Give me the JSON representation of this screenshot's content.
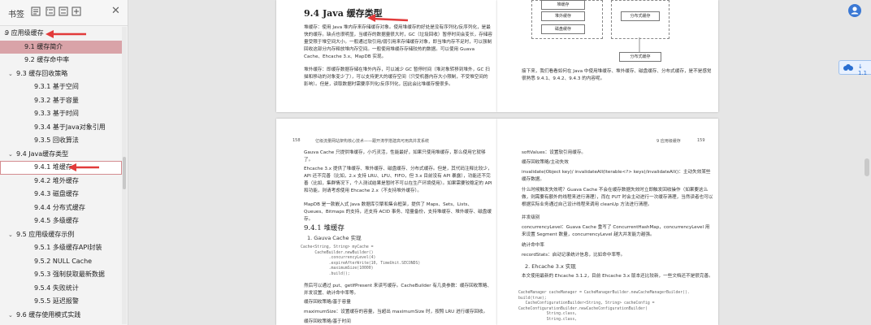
{
  "sidebar": {
    "title": "书签",
    "close": "✕",
    "toc": [
      {
        "chev": "⌄",
        "label": "9  应用级缓存",
        "indent": 6,
        "hl": false,
        "box": false
      },
      {
        "chev": "",
        "label": "9.1  缓存简介",
        "indent": 30,
        "hl": true,
        "box": false
      },
      {
        "chev": "",
        "label": "9.2  缓存命中率",
        "indent": 30,
        "hl": false,
        "box": false
      },
      {
        "chev": "⌄",
        "label": "9.3  缓存回收策略",
        "indent": 20,
        "hl": false,
        "box": false
      },
      {
        "chev": "",
        "label": "9.3.1  基于空间",
        "indent": 42,
        "hl": false,
        "box": false
      },
      {
        "chev": "",
        "label": "9.3.2  基于容量",
        "indent": 42,
        "hl": false,
        "box": false
      },
      {
        "chev": "",
        "label": "9.3.3  基于时间",
        "indent": 42,
        "hl": false,
        "box": false
      },
      {
        "chev": "",
        "label": "9.3.4  基于Java对象引用",
        "indent": 42,
        "hl": false,
        "box": false
      },
      {
        "chev": "",
        "label": "9.3.5  回收算法",
        "indent": 42,
        "hl": false,
        "box": false
      },
      {
        "chev": "⌄",
        "label": "9.4  Java缓存类型",
        "indent": 20,
        "hl": false,
        "box": false
      },
      {
        "chev": "",
        "label": "9.4.1  堆缓存",
        "indent": 42,
        "hl": false,
        "box": true
      },
      {
        "chev": "",
        "label": "9.4.2  堆外缓存",
        "indent": 42,
        "hl": false,
        "box": false
      },
      {
        "chev": "",
        "label": "9.4.3  磁盘缓存",
        "indent": 42,
        "hl": false,
        "box": false
      },
      {
        "chev": "",
        "label": "9.4.4  分布式缓存",
        "indent": 42,
        "hl": false,
        "box": false
      },
      {
        "chev": "",
        "label": "9.4.5  多级缓存",
        "indent": 42,
        "hl": false,
        "box": false
      },
      {
        "chev": "⌄",
        "label": "9.5  应用级缓存示例",
        "indent": 20,
        "hl": false,
        "box": false
      },
      {
        "chev": "",
        "label": "9.5.1  多级缓存API封装",
        "indent": 42,
        "hl": false,
        "box": false
      },
      {
        "chev": "",
        "label": "9.5.2  NULL Cache",
        "indent": 42,
        "hl": false,
        "box": false
      },
      {
        "chev": "",
        "label": "9.5.3  强制获取最新数据",
        "indent": 42,
        "hl": false,
        "box": false
      },
      {
        "chev": "",
        "label": "9.5.4  失败统计",
        "indent": 42,
        "hl": false,
        "box": false
      },
      {
        "chev": "",
        "label": "9.5.5  延迟报警",
        "indent": 42,
        "hl": false,
        "box": false
      },
      {
        "chev": "⌄",
        "label": "9.6  缓存使用模式实践",
        "indent": 20,
        "hl": false,
        "box": false
      }
    ]
  },
  "pages": {
    "top_left": {
      "heading": "9.4   Java 缓存类型",
      "para1": "堆缓存：使用 Java 堆内存来存储缓存对象。使用堆缓存的好处是没有序列化/反序列化，是最快的缓存。缺点也很明显，当缓存的数据量很大时，GC（垃圾回收）暂停时间会变长，存储容量受限于堆空间大小。一般通过软引用/弱引用来存储缓存对象，即当堆内存不足时，可以强制回收这部分内存释放堆内存空间。一般使用堆缓存存储较热的数据。可以使用 Guava Cache、Ehcache 3.x、MapDB 实现。",
      "para2": "堆外缓存：即缓存数据存储在堆外内存，可以减少 GC 暂停时间（堆对象转移到堆外，GC 扫描和移动的对象变少了），可以支持更大的缓存空间（只受机器内存大小限制，不受堆空间的影响）。但是，读取数据时需要序列化/反序列化，因此会比堆缓存慢很多。"
    },
    "top_right": {
      "diagram": [
        "堆缓存",
        "堆外缓存",
        "磁盘缓存",
        "分布式缓存",
        "分布式缓存"
      ],
      "para": "接下来，我们看看如何在 Java 中使用堆缓存、堆外缓存、磁盘缓存、分布式缓存，是不是感觉很熟悉 9.4.1、9.4.2、9.4.3 的内容呢。"
    },
    "bot_left": {
      "page_no": "158",
      "runhead": "亿级流量网站架构核心技术——跟开涛学搭建高可用高并发系统",
      "para1": "Gauva Cache 只提供堆缓存，小巧灵活，性能最好，如果只使用堆缓存，那么使用它就够了。",
      "para2": "Ehcache 3.x 提供了堆缓存、堆外缓存、磁盘缓存、分布式缓存。但是，其代码注释比较少，API 还不完善（比如，2.x 支持 LRU、LFU、FIFO，但 3.x 目前没有 API 暴露），功能还不完善（比如，集群情况下，个人测试结果是暂时不可以在生产环境使用）。如果需要较稳定的 API 和功能，则请考虑使用 Ehcache 2.x（不支持堆外缓存）。",
      "para3": "MapDB 是一款嵌入式 Java 数据库引擎和集合框架，提供了 Maps、Sets、Lists、Queues、Bitmaps 的支持，还支持 ACID 事务、增量备份，支持堆缓存、堆外缓存、磁盘缓存。",
      "h_941": "9.4.1    堆缓存",
      "h_1": "1.  Gauva Cache 实现",
      "code": "Cache<String, String> myCache =\n      CacheBuilder.newBuilder()\n            .concurrencyLevel(4)\n            .expireAfterWrite(10, TimeUnit.SECONDS)\n            .maximumSize(10000)\n            .build();",
      "para4": "然后可以通过 put、getIfPresent 来读写缓存。CacheBuilder 有几类参数：缓存回收策略、并发设置、统计命中率等。",
      "para5": "缓存回收策略/基于容量",
      "para6": "maximumSize：设置缓存的容量，当超出 maximumSize 时，按照 LRU 进行缓存回收。",
      "para7": "缓存回收策略/基于时间"
    },
    "bot_right": {
      "page_no": "159",
      "runhead": "9   应用级缓存",
      "lines": [
        "softValues：设置软引用缓存。",
        "缓存回收策略/主动失效",
        "invalidate(Object key)/ invalidateAll(Iterable<?> keys)/invalidateAll()：主动失效某些缓存数据。",
        "什么时候触发失效呢？Guava Cache 不会在缓存数据失效时立即触发回收操作（如果要这么做，则需要有额外的线程来进行清理），而在 PUT 时会主动进行一次缓存清理，当然读者也可以根据实际业务通过自己设计线程来调用 cleanUp 方法进行清理。",
        "并发级别",
        "concurrencyLevel：Guava Cache 重写了 ConcurrentHashMap，concurrencyLevel 用来设置 Segment 数量，concurrencyLevel 越大并发能力越强。",
        "统计命中率",
        "recordStats：启动记录统计信息，比如命中率等。"
      ],
      "h_2": "2.  Ehcache 3.x 实现",
      "para_end": "本文使用最新的 Ehcache 3.1.2，目前 Ehcache 3.x 版本还比较新，一些文档还不是很完善。",
      "code": "CacheManager cacheManager = CacheManagerBuilder.newCacheManagerBuilder().\nbuild(true);\n   CacheConfigurationBuilder<String, String> cacheConfig =\nCacheConfigurationBuilder.newCacheConfigurationBuilder(\n            String.class,\n            String.class,"
    }
  },
  "widgets": {
    "badge_text": "↓ 1.1"
  },
  "colors": {
    "highlight": "#d9a3a8",
    "arrow": "#e23b3b",
    "accent": "#3a78d4"
  }
}
